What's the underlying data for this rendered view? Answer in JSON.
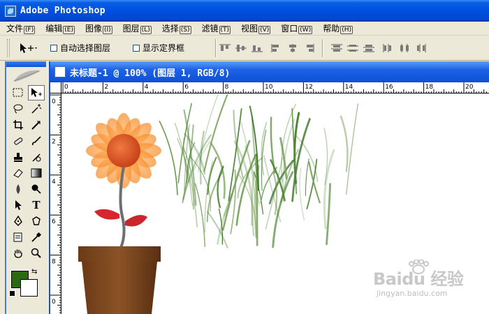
{
  "window": {
    "title": "Adobe Photoshop"
  },
  "menu": [
    {
      "label": "文件",
      "key": "F"
    },
    {
      "label": "编辑",
      "key": "E"
    },
    {
      "label": "图像",
      "key": "I"
    },
    {
      "label": "图层",
      "key": "L"
    },
    {
      "label": "选择",
      "key": "S"
    },
    {
      "label": "滤镜",
      "key": "T"
    },
    {
      "label": "视图",
      "key": "V"
    },
    {
      "label": "窗口",
      "key": "W"
    },
    {
      "label": "帮助",
      "key": "H"
    }
  ],
  "options": {
    "auto_select": "自动选择图层",
    "show_bounds": "显示定界框"
  },
  "document": {
    "title": "未标题-1 @ 100% (图层 1, RGB/8)",
    "ruler_top_labels": [
      "0",
      "2",
      "4",
      "6",
      "8",
      "10",
      "12",
      "14",
      "16",
      "18",
      "20"
    ],
    "ruler_left_labels": [
      "0",
      "2",
      "4",
      "6",
      "8",
      "0"
    ]
  },
  "colors": {
    "foreground": "#2b6a12",
    "background": "#ffffff"
  },
  "watermark": {
    "logo": "Baidu 经验",
    "url": "jingyan.baidu.com"
  }
}
